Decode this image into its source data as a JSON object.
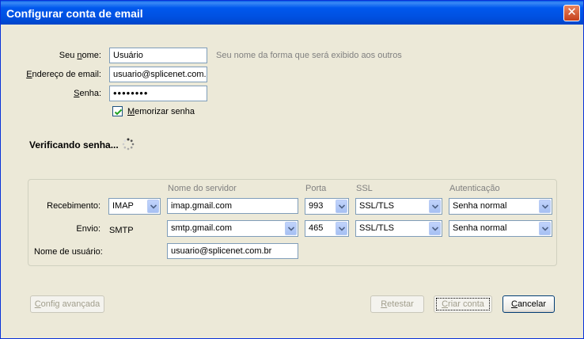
{
  "window": {
    "title": "Configurar conta de email",
    "close_icon": "close-icon"
  },
  "form": {
    "name_label": "Seu nome:",
    "name_value": "Usuário",
    "name_hint": "Seu nome da forma que será exibido aos outros",
    "email_label": "Endereço de email:",
    "email_value": "usuario@splicenet.com.b",
    "password_label": "Senha:",
    "password_value": "••••••••",
    "remember_label": "Memorizar senha",
    "remember_checked": true
  },
  "status": {
    "text": "Verificando senha..."
  },
  "servers": {
    "headers": {
      "server": "Nome do servidor",
      "port": "Porta",
      "ssl": "SSL",
      "auth": "Autenticação"
    },
    "incoming": {
      "label": "Recebimento:",
      "protocol": "IMAP",
      "server": "imap.gmail.com",
      "port": "993",
      "ssl": "SSL/TLS",
      "auth": "Senha normal"
    },
    "outgoing": {
      "label": "Envio:",
      "protocol": "SMTP",
      "server": "smtp.gmail.com",
      "port": "465",
      "ssl": "SSL/TLS",
      "auth": "Senha normal"
    },
    "username_label": "Nome de usuário:",
    "username_value": "usuario@splicenet.com.br"
  },
  "buttons": {
    "advanced": "Config avançada",
    "retest": "Retestar",
    "create": "Criar conta",
    "cancel": "Cancelar"
  },
  "colors": {
    "titlebar": "#0054E3",
    "window_bg": "#ECE9D8",
    "field_border": "#7F9DB9"
  }
}
